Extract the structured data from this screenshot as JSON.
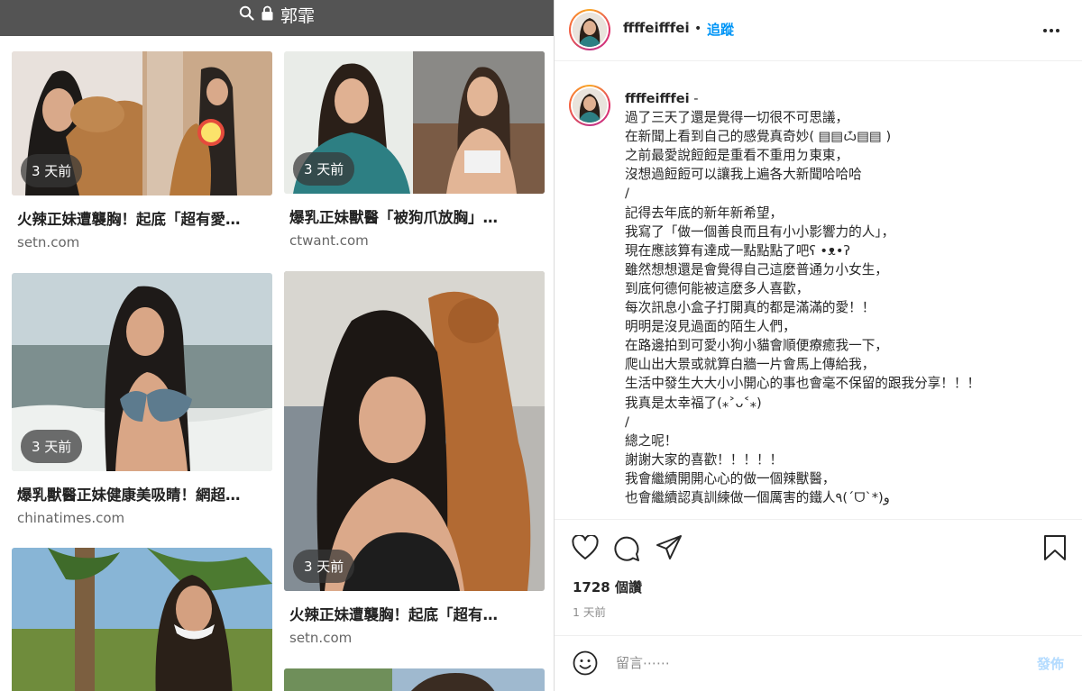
{
  "search": {
    "query": "郭霏",
    "search_icon": "search-icon",
    "lock_icon": "lock-icon"
  },
  "results": [
    {
      "age": "3 天前",
      "title": "火辣正妹遭襲胸！起底「超有愛…",
      "source": "setn.com"
    },
    {
      "age": "3 天前",
      "title": "爆乳正妹獸醫「被狗爪放胸」…",
      "source": "ctwant.com"
    },
    {
      "age": "3 天前",
      "title": "爆乳獸醫正妹健康美吸睛！網超…",
      "source": "chinatimes.com"
    },
    {
      "age": "3 天前",
      "title": "火辣正妹遭襲胸！起底「超有…",
      "source": "setn.com"
    }
  ],
  "post": {
    "username": "ffffeifffei",
    "dot": "•",
    "follow_label": "追蹤",
    "caption_username": "ffffeifffei",
    "caption_lines": [
      "-",
      "過了三天了還是覺得一切很不可思議，",
      "在新聞上看到自己的感覺真奇妙( ▤▤ѽ▤▤ )",
      "之前最愛說餖餖是重看不重用ㄉ東東，",
      "沒想過餖餖可以讓我上遍各大新聞哈哈哈",
      "/",
      "記得去年底的新年新希望，",
      "我寫了「做一個善良而且有小小影響力的人」，",
      "現在應該算有達成一點點點了吧ʕ •ᴥ•ʔ",
      "雖然想想還是會覺得自己這麼普通ㄉ小女生，",
      "到底何德何能被這麼多人喜歡，",
      "每次訊息小盒子打開真的都是滿滿的愛！！",
      "明明是沒見過面的陌生人們，",
      "在路邊拍到可愛小狗小貓會順便療癒我一下，",
      "爬山出大景或就算白牆一片會馬上傳給我，",
      "生活中發生大大小小開心的事也會毫不保留的跟我分享！！！",
      "我真是太幸福了(⁎˃ᴗ˂⁎)",
      "/",
      "總之呢！",
      "謝謝大家的喜歡！！！！！",
      "我會繼續開開心心的做一個辣獸醫，",
      "也會繼續認真訓練做一個厲害的鐵人٩(ˊᗜˋ*)و"
    ],
    "likes": "1728 個讚",
    "time_ago": "1 天前",
    "comment_placeholder": "留言⋯⋯",
    "post_label": "發佈",
    "icons": [
      "heart-icon",
      "comment-icon",
      "share-icon",
      "bookmark-icon",
      "more-icon",
      "emoji-icon"
    ]
  },
  "colors": {
    "link_blue": "#0095f6",
    "post_disabled": "#b3dbff",
    "topbar": "#545454"
  }
}
